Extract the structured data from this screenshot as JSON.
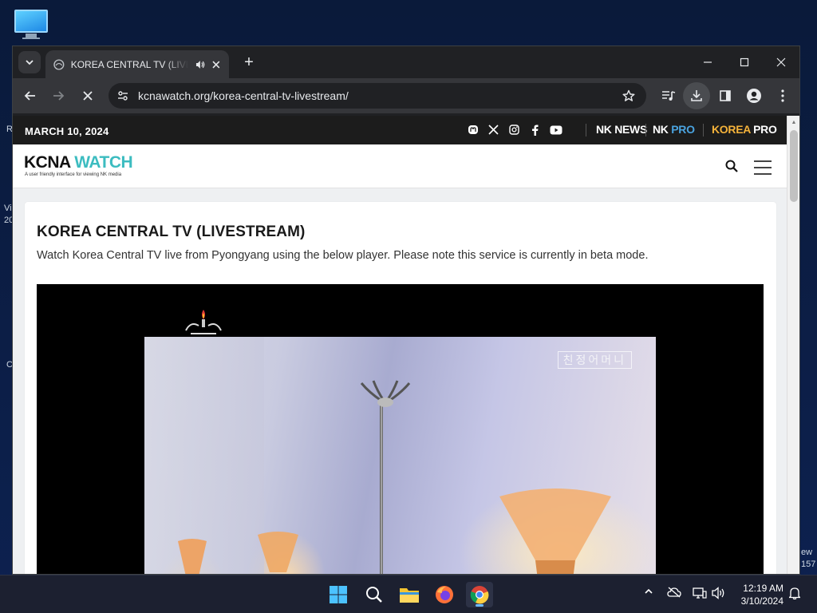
{
  "desktop": {
    "fragments": [
      "R",
      "Vi",
      "20",
      "C",
      "ew",
      "157"
    ]
  },
  "browser": {
    "tab": {
      "title": "KOREA CENTRAL TV (LIVESTREAM)",
      "icons": [
        "tab-search-icon",
        "favicon-icon",
        "audio-playing-icon",
        "close-tab-icon"
      ]
    },
    "new_tab_label": "+",
    "url": "kcnawatch.org/korea-central-tv-livestream/"
  },
  "site": {
    "date": "MARCH 10, 2024",
    "social_icons": [
      "mastodon-icon",
      "x-icon",
      "instagram-icon",
      "facebook-icon",
      "youtube-icon"
    ],
    "brands": {
      "nknews": "NK NEWS",
      "nkpro_a": "NK",
      "nkpro_b": " PRO",
      "koreapro_a": "KOREA",
      "koreapro_b": " PRO"
    },
    "logo": {
      "part1": "KCNA",
      "part2": " WATCH",
      "tagline": "A user friendly interface for viewing NK media"
    },
    "page": {
      "title": "KOREA CENTRAL TV (LIVESTREAM)",
      "description": "Watch Korea Central TV live from Pyongyang using the below player. Please note this service is currently in beta mode."
    },
    "player": {
      "overlay_caption": "친정어머니"
    }
  },
  "taskbar": {
    "apps": [
      "start-icon",
      "search-icon",
      "file-explorer-icon",
      "firefox-icon",
      "chrome-icon"
    ],
    "clock": {
      "time": "12:19 AM",
      "date": "3/10/2024"
    }
  },
  "colors": {
    "accent_teal": "#3cbcc0",
    "korea_pro_gold": "#f4b23a",
    "nk_pro_blue": "#4aa3df"
  }
}
